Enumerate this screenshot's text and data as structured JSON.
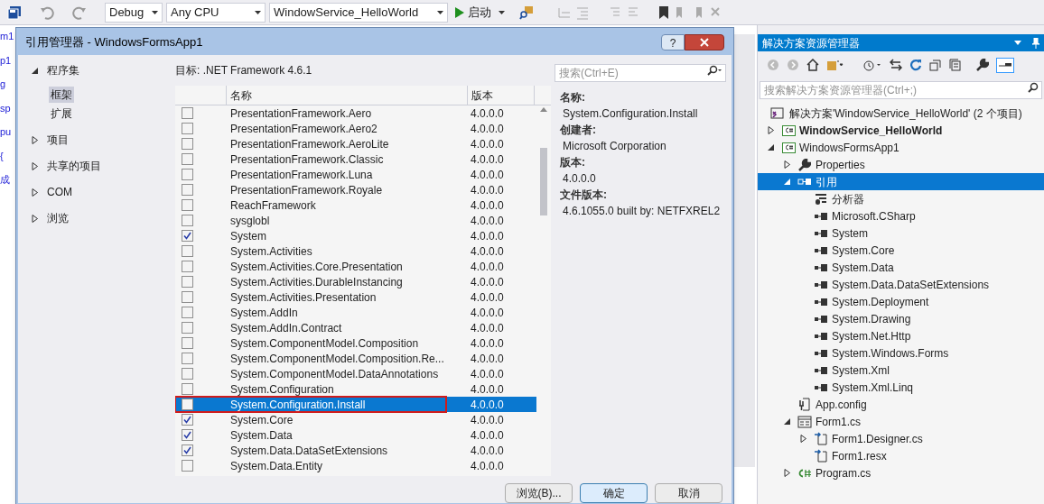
{
  "toolbar": {
    "configuration": "Debug",
    "platform": "Any CPU",
    "startup_project": "WindowService_HelloWorld",
    "start_button": "启动"
  },
  "editor_fragments": [
    "m1",
    "p1",
    "g",
    "sp",
    "pu",
    "{",
    "成"
  ],
  "dialog": {
    "title": "引用管理器 - WindowsFormsApp1",
    "help_button": "?",
    "nav": [
      {
        "label": "程序集",
        "expanded": true,
        "children": [
          {
            "label": "框架",
            "selected": true
          },
          {
            "label": "扩展",
            "selected": false
          }
        ]
      },
      {
        "label": "项目",
        "expanded": false
      },
      {
        "label": "共享的项目",
        "expanded": false
      },
      {
        "label": "COM",
        "expanded": false
      },
      {
        "label": "浏览",
        "expanded": false
      }
    ],
    "target": "目标: .NET Framework 4.6.1",
    "search": {
      "placeholder": "搜索(Ctrl+E)"
    },
    "columns": [
      "名称",
      "版本"
    ],
    "rows": [
      {
        "name": "PresentationFramework.Aero",
        "version": "4.0.0.0",
        "checked": false,
        "selected": false
      },
      {
        "name": "PresentationFramework.Aero2",
        "version": "4.0.0.0",
        "checked": false,
        "selected": false
      },
      {
        "name": "PresentationFramework.AeroLite",
        "version": "4.0.0.0",
        "checked": false,
        "selected": false
      },
      {
        "name": "PresentationFramework.Classic",
        "version": "4.0.0.0",
        "checked": false,
        "selected": false
      },
      {
        "name": "PresentationFramework.Luna",
        "version": "4.0.0.0",
        "checked": false,
        "selected": false
      },
      {
        "name": "PresentationFramework.Royale",
        "version": "4.0.0.0",
        "checked": false,
        "selected": false
      },
      {
        "name": "ReachFramework",
        "version": "4.0.0.0",
        "checked": false,
        "selected": false
      },
      {
        "name": "sysglobl",
        "version": "4.0.0.0",
        "checked": false,
        "selected": false
      },
      {
        "name": "System",
        "version": "4.0.0.0",
        "checked": true,
        "selected": false
      },
      {
        "name": "System.Activities",
        "version": "4.0.0.0",
        "checked": false,
        "selected": false
      },
      {
        "name": "System.Activities.Core.Presentation",
        "version": "4.0.0.0",
        "checked": false,
        "selected": false
      },
      {
        "name": "System.Activities.DurableInstancing",
        "version": "4.0.0.0",
        "checked": false,
        "selected": false
      },
      {
        "name": "System.Activities.Presentation",
        "version": "4.0.0.0",
        "checked": false,
        "selected": false
      },
      {
        "name": "System.AddIn",
        "version": "4.0.0.0",
        "checked": false,
        "selected": false
      },
      {
        "name": "System.AddIn.Contract",
        "version": "4.0.0.0",
        "checked": false,
        "selected": false
      },
      {
        "name": "System.ComponentModel.Composition",
        "version": "4.0.0.0",
        "checked": false,
        "selected": false
      },
      {
        "name": "System.ComponentModel.Composition.Re...",
        "version": "4.0.0.0",
        "checked": false,
        "selected": false
      },
      {
        "name": "System.ComponentModel.DataAnnotations",
        "version": "4.0.0.0",
        "checked": false,
        "selected": false
      },
      {
        "name": "System.Configuration",
        "version": "4.0.0.0",
        "checked": false,
        "selected": false
      },
      {
        "name": "System.Configuration.Install",
        "version": "4.0.0.0",
        "checked": false,
        "selected": true,
        "annotated": true
      },
      {
        "name": "System.Core",
        "version": "4.0.0.0",
        "checked": true,
        "selected": false
      },
      {
        "name": "System.Data",
        "version": "4.0.0.0",
        "checked": true,
        "selected": false
      },
      {
        "name": "System.Data.DataSetExtensions",
        "version": "4.0.0.0",
        "checked": true,
        "selected": false
      },
      {
        "name": "System.Data.Entity",
        "version": "4.0.0.0",
        "checked": false,
        "selected": false
      }
    ],
    "details": [
      {
        "label": "名称:",
        "value": "System.Configuration.Install"
      },
      {
        "label": "创建者:",
        "value": "Microsoft Corporation"
      },
      {
        "label": "版本:",
        "value": "4.0.0.0"
      },
      {
        "label": "文件版本:",
        "value": "4.6.1055.0 built by: NETFXREL2"
      }
    ],
    "buttons": [
      {
        "label": "浏览(B)...",
        "default": false
      },
      {
        "label": "确定",
        "default": true
      },
      {
        "label": "取消",
        "default": false
      }
    ]
  },
  "solution_explorer": {
    "title": "解决方案资源管理器",
    "search": {
      "placeholder": "搜索解决方案资源管理器(Ctrl+;)"
    },
    "solution": "解决方案'WindowService_HelloWorld' (2 个项目)",
    "tree": [
      {
        "label": "WindowService_HelloWorld",
        "kind": "project",
        "bold": true,
        "expanded": false,
        "selected": false
      },
      {
        "label": "WindowsFormsApp1",
        "kind": "project",
        "bold": false,
        "expanded": true,
        "selected": false,
        "children": [
          {
            "label": "Properties",
            "kind": "wrench",
            "bold": false,
            "expanded": false,
            "selected": false
          },
          {
            "label": "引用",
            "kind": "references",
            "bold": false,
            "expanded": true,
            "selected": true,
            "children": [
              {
                "label": "分析器",
                "kind": "analyzer",
                "bold": false,
                "selected": false
              },
              {
                "label": "Microsoft.CSharp",
                "kind": "reference",
                "bold": false,
                "selected": false
              },
              {
                "label": "System",
                "kind": "reference",
                "bold": false,
                "selected": false
              },
              {
                "label": "System.Core",
                "kind": "reference",
                "bold": false,
                "selected": false
              },
              {
                "label": "System.Data",
                "kind": "reference",
                "bold": false,
                "selected": false
              },
              {
                "label": "System.Data.DataSetExtensions",
                "kind": "reference",
                "bold": false,
                "selected": false
              },
              {
                "label": "System.Deployment",
                "kind": "reference",
                "bold": false,
                "selected": false
              },
              {
                "label": "System.Drawing",
                "kind": "reference",
                "bold": false,
                "selected": false
              },
              {
                "label": "System.Net.Http",
                "kind": "reference",
                "bold": false,
                "selected": false
              },
              {
                "label": "System.Windows.Forms",
                "kind": "reference",
                "bold": false,
                "selected": false
              },
              {
                "label": "System.Xml",
                "kind": "reference",
                "bold": false,
                "selected": false
              },
              {
                "label": "System.Xml.Linq",
                "kind": "reference",
                "bold": false,
                "selected": false
              }
            ]
          },
          {
            "label": "App.config",
            "kind": "config",
            "bold": false,
            "selected": false
          },
          {
            "label": "Form1.cs",
            "kind": "form",
            "bold": false,
            "expanded": true,
            "selected": false,
            "children": [
              {
                "label": "Form1.Designer.cs",
                "kind": "file",
                "bold": false,
                "expanded": false,
                "selected": false
              },
              {
                "label": "Form1.resx",
                "kind": "file",
                "bold": false,
                "selected": false
              }
            ]
          },
          {
            "label": "Program.cs",
            "kind": "csharp",
            "bold": false,
            "expanded": false,
            "selected": false
          }
        ]
      }
    ]
  }
}
